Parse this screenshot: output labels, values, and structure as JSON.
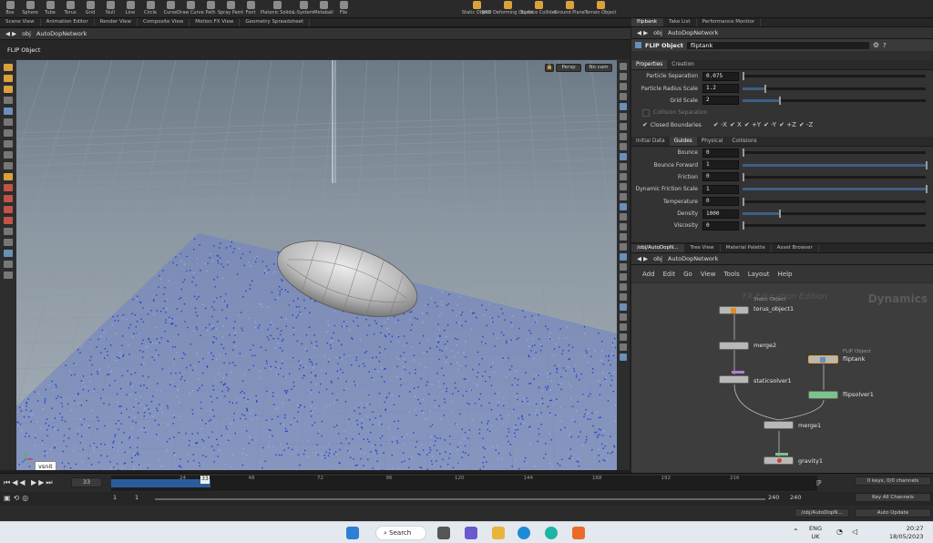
{
  "shelf": {
    "tools": [
      "Box",
      "Sphere",
      "Tube",
      "Torus",
      "Grid",
      "Null",
      "Line",
      "Circle",
      "Curve",
      "Draw Curve",
      "Path",
      "Spray Paint",
      "Font",
      "Platonic Solids",
      "L-System",
      "Metaball",
      "File"
    ],
    "dyn_tools": [
      "Static Object",
      "RBD Deforming Object",
      "Surface Collider",
      "Ground Plane",
      "Terrain Object"
    ],
    "tabs": [
      "Scene View",
      "Animation Editor",
      "Render View",
      "Composite View",
      "Motion FX View",
      "Geometry Spreadsheet"
    ]
  },
  "viewport": {
    "path": [
      "obj",
      "AutoDopNetwork"
    ],
    "title": "FLIP Object",
    "persp_label": "Persp",
    "cam_label": "No cam",
    "axis_tooltip": "vsnit"
  },
  "params": {
    "tabs": [
      "flipbank",
      "Take List",
      "Performance Monitor"
    ],
    "path": [
      "obj",
      "AutoDopNetwork"
    ],
    "node_type": "FLIP Object",
    "node_name": "fliptank",
    "subtabs": [
      "Properties",
      "Creation"
    ],
    "rows1": [
      {
        "label": "Particle Separation",
        "value": "0.075",
        "fill": 0
      },
      {
        "label": "Particle Radius Scale",
        "value": "1.2",
        "fill": 0.12
      },
      {
        "label": "Grid Scale",
        "value": "2",
        "fill": 0.2
      }
    ],
    "collision_label": "Collision Separation",
    "closed_label": "Closed Boundaries",
    "axes": [
      "-X",
      "X",
      "+Y",
      "-Y",
      "+Z",
      "-Z"
    ],
    "subtabs2": [
      "Initial Data",
      "Guides",
      "Physical",
      "Collisions"
    ],
    "rows2": [
      {
        "label": "Bounce",
        "value": "0",
        "fill": 0
      },
      {
        "label": "Bounce Forward",
        "value": "1",
        "fill": 1
      },
      {
        "label": "Friction",
        "value": "0",
        "fill": 0
      },
      {
        "label": "Dynamic Friction Scale",
        "value": "1",
        "fill": 1
      },
      {
        "label": "Temperature",
        "value": "0",
        "fill": 0
      },
      {
        "label": "Density",
        "value": "1000",
        "fill": 0.2
      },
      {
        "label": "Viscosity",
        "value": "0",
        "fill": 0
      }
    ]
  },
  "network": {
    "tabs": [
      "/obj/AutoDopN...",
      "Tree View",
      "Material Palette",
      "Asset Browser"
    ],
    "path": [
      "obj",
      "AutoDopNetwork"
    ],
    "menu": [
      "Add",
      "Edit",
      "Go",
      "View",
      "Tools",
      "Layout",
      "Help"
    ],
    "watermark_edition": "FX Education Edition",
    "watermark_context": "Dynamics",
    "nodes": {
      "torus_sub": "Static Object",
      "torus": "torus_object1",
      "merge2": "merge2",
      "staticsolver": "staticsolver1",
      "flip_sub": "FLIP Object",
      "fliptank": "fliptank",
      "flipsolver": "flipsolver1",
      "merge1": "merge1",
      "gravity": "gravity1"
    }
  },
  "timeline": {
    "current_frame": "33",
    "ticks": [
      "24",
      "48",
      "72",
      "96",
      "120",
      "144",
      "168",
      "192",
      "216"
    ],
    "start": "1",
    "start2": "1",
    "end": "240",
    "end2": "240",
    "keys_label": "0 keys, 0/0 channels",
    "key_all": "Key All Channels",
    "update_path": "/obj/AutoDopN...",
    "auto_update": "Auto Update",
    "progress": 0.14
  },
  "taskbar": {
    "search": "Search",
    "lang1": "ENG",
    "lang2": "UK",
    "time": "20:27",
    "date": "18/05/2023"
  }
}
